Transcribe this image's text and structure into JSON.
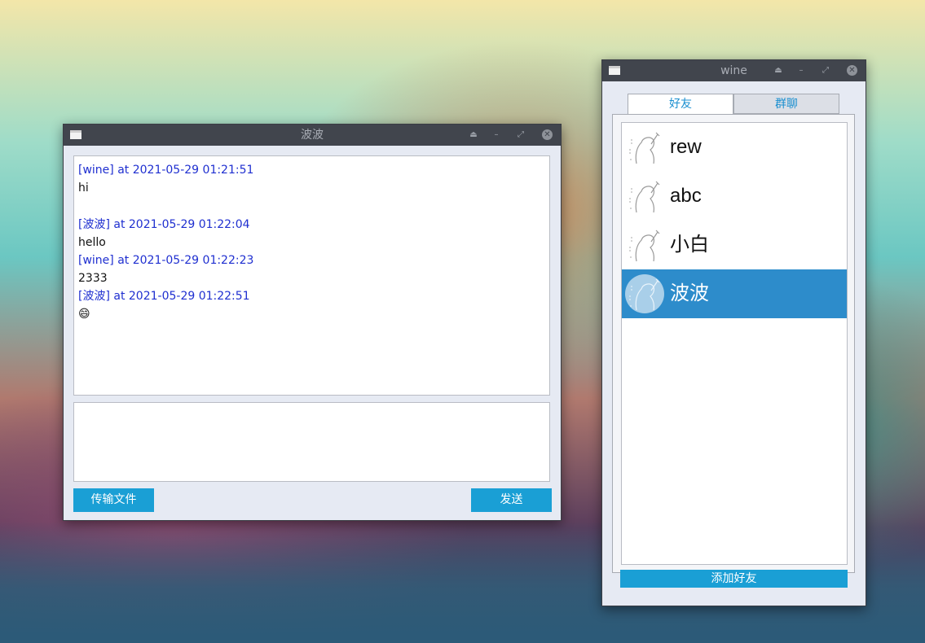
{
  "chat_window": {
    "title": "波波",
    "messages": [
      {
        "header": "[wine] at 2021-05-29 01:21:51",
        "text": "hi"
      },
      {
        "header": "[波波] at 2021-05-29 01:22:04",
        "text": "hello"
      },
      {
        "header": "[wine] at 2021-05-29 01:22:23",
        "text": "2333"
      },
      {
        "header": "[波波] at 2021-05-29 01:22:51",
        "text": "😄"
      }
    ],
    "input_value": "",
    "send_file_label": "传输文件",
    "send_label": "发送"
  },
  "friends_window": {
    "title": "wine",
    "tabs": [
      {
        "label": "好友"
      },
      {
        "label": "群聊"
      }
    ],
    "friends": [
      {
        "name": "rew"
      },
      {
        "name": "abc"
      },
      {
        "name": "小白"
      },
      {
        "name": "波波"
      }
    ],
    "add_friend_label": "添加好友"
  },
  "colors": {
    "accent_button": "#1a9fd5",
    "selected_row": "#2d8ccb",
    "message_header": "#1f2fd0",
    "titlebar": "#41454d"
  },
  "icons": [
    "app-window-icon",
    "eject-icon",
    "minimize-icon",
    "maximize-icon",
    "close-icon",
    "avatar-sketch-icon"
  ]
}
